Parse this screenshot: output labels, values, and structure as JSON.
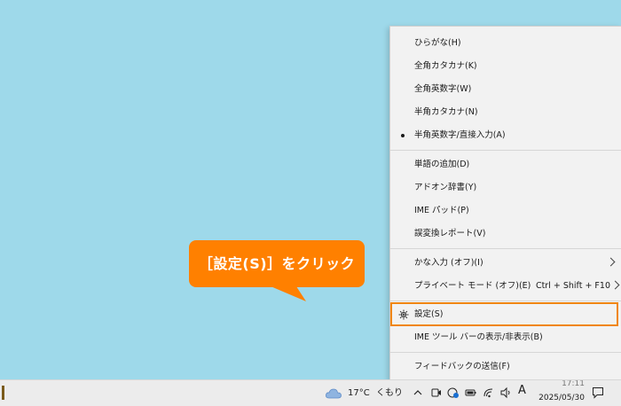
{
  "menu": {
    "items": [
      {
        "label": "ひらがな(H)"
      },
      {
        "label": "全角カタカナ(K)"
      },
      {
        "label": "全角英数字(W)"
      },
      {
        "label": "半角カタカナ(N)"
      },
      {
        "label": "半角英数字/直接入力(A)",
        "checked": true
      },
      {
        "label": "単語の追加(D)"
      },
      {
        "label": "アドオン辞書(Y)"
      },
      {
        "label": "IME パッド(P)"
      },
      {
        "label": "誤変換レポート(V)"
      },
      {
        "label": "かな入力 (オフ)(I)",
        "submenu": true
      },
      {
        "label": "プライベート モード (オフ)(E)",
        "shortcut": "Ctrl + Shift + F10",
        "submenu": true
      },
      {
        "label": "設定(S)",
        "icon": "gear-icon",
        "highlighted": true
      },
      {
        "label": "IME ツール バーの表示/非表示(B)"
      },
      {
        "label": "フィードバックの送信(F)"
      }
    ]
  },
  "callout": {
    "text": "［設定(S)］をクリック",
    "color": "#ff8000"
  },
  "highlight_color": "#f0860f",
  "taskbar": {
    "weather": {
      "icon": "cloud-icon",
      "temperature": "17°C",
      "condition": "くもり"
    },
    "tray_icons": [
      "chevron-up-icon",
      "camera-icon",
      "security-icon",
      "battery-icon",
      "wifi-icon",
      "speaker-icon"
    ],
    "ime_indicator": "A",
    "time": "17:11",
    "date": "2025/05/30",
    "notification_icon": "notification-icon"
  }
}
